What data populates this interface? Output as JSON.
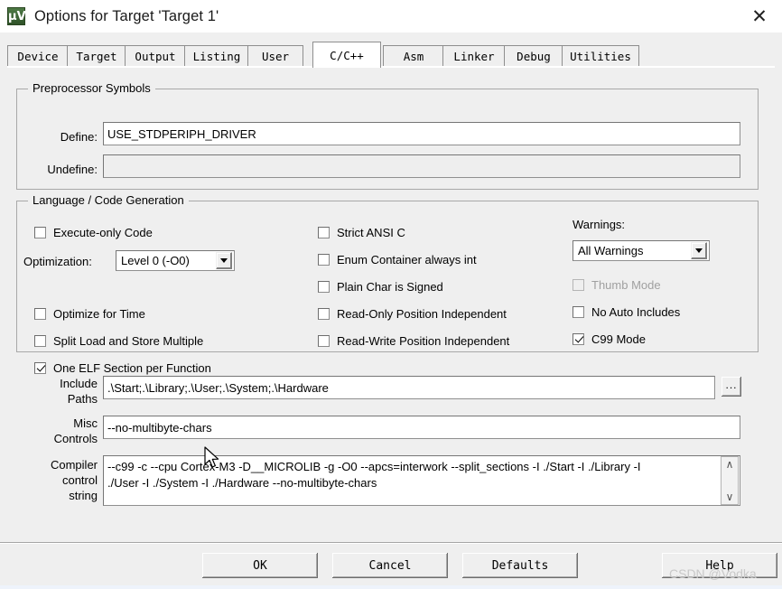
{
  "window": {
    "title": "Options for Target 'Target 1'",
    "icon": "keil-uvision-icon",
    "icon_glyph": "µV",
    "close_label": "✕"
  },
  "tabs": [
    {
      "label": "Device",
      "active": false
    },
    {
      "label": "Target",
      "active": false
    },
    {
      "label": "Output",
      "active": false
    },
    {
      "label": "Listing",
      "active": false
    },
    {
      "label": "User",
      "active": false
    },
    {
      "label": "C/C++",
      "active": true
    },
    {
      "label": "Asm",
      "active": false
    },
    {
      "label": "Linker",
      "active": false
    },
    {
      "label": "Debug",
      "active": false
    },
    {
      "label": "Utilities",
      "active": false
    }
  ],
  "preprocessor": {
    "legend": "Preprocessor Symbols",
    "define_label": "Define:",
    "define_value": "USE_STDPERIPH_DRIVER",
    "undefine_label": "Undefine:",
    "undefine_value": "",
    "undefine_disabled": true
  },
  "language": {
    "legend": "Language / Code Generation",
    "left_column": [
      {
        "label": "Execute-only Code",
        "checked": false,
        "disabled": false
      },
      {
        "label": "Optimize for Time",
        "checked": false,
        "disabled": false
      },
      {
        "label": "Split Load and Store Multiple",
        "checked": false,
        "disabled": false
      },
      {
        "label": "One ELF Section per Function",
        "checked": true,
        "disabled": false
      }
    ],
    "optimization_label": "Optimization:",
    "optimization_value": "Level 0 (-O0)",
    "middle_column": [
      {
        "label": "Strict ANSI C",
        "checked": false,
        "disabled": false
      },
      {
        "label": "Enum Container always int",
        "checked": false,
        "disabled": false
      },
      {
        "label": "Plain Char is Signed",
        "checked": false,
        "disabled": false
      },
      {
        "label": "Read-Only Position Independent",
        "checked": false,
        "disabled": false
      },
      {
        "label": "Read-Write Position Independent",
        "checked": false,
        "disabled": false
      }
    ],
    "warnings_label": "Warnings:",
    "warnings_value": "All Warnings",
    "right_column": [
      {
        "label": "Thumb Mode",
        "checked": false,
        "disabled": true
      },
      {
        "label": "No Auto Includes",
        "checked": false,
        "disabled": false
      },
      {
        "label": "C99 Mode",
        "checked": true,
        "disabled": false
      }
    ]
  },
  "paths": {
    "include_label_line1": "Include",
    "include_label_line2": "Paths",
    "include_value": ".\\Start;.\\Library;.\\User;.\\System;.\\Hardware",
    "browse_label": "...",
    "misc_label_line1": "Misc",
    "misc_label_line2": "Controls",
    "misc_value": "--no-multibyte-chars",
    "compiler_label_line1": "Compiler",
    "compiler_label_line2": "control",
    "compiler_label_line3": "string",
    "compiler_value_line1": "--c99 -c --cpu Cortex-M3 -D__MICROLIB -g -O0 --apcs=interwork --split_sections -I ./Start -I ./Library -I",
    "compiler_value_line2": "./User -I ./System -I ./Hardware --no-multibyte-chars",
    "scroll_up": "∧",
    "scroll_down": "∨"
  },
  "buttons": [
    {
      "name": "ok-button",
      "label": "OK"
    },
    {
      "name": "cancel-button",
      "label": "Cancel"
    },
    {
      "name": "defaults-button",
      "label": "Defaults"
    },
    {
      "name": "help-button",
      "label": "Help"
    }
  ],
  "watermark": {
    "text": "CSDN @Vodka"
  },
  "colors": {
    "dialog_bg": "#efefef",
    "field_bg": "#ffffff",
    "border": "#a8a8a8",
    "disabled_text": "#a0a0a0",
    "watermark": "#c8c8c8"
  }
}
